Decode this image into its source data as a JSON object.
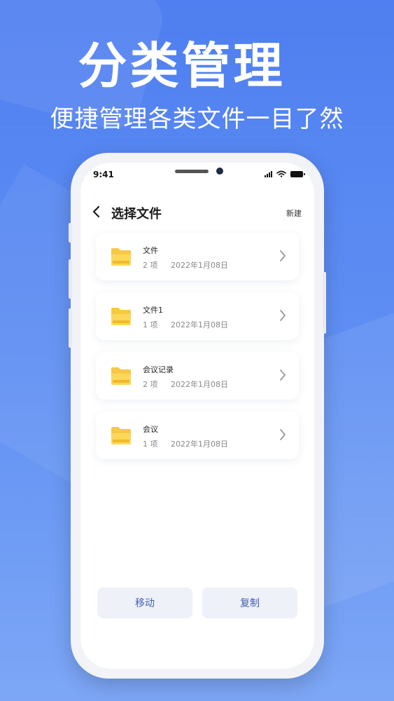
{
  "headline": "分类管理",
  "subline": "便捷管理各类文件一目了然",
  "status": {
    "time": "9:41"
  },
  "nav": {
    "title": "选择文件",
    "new_label": "新建"
  },
  "folders": [
    {
      "name": "文件",
      "count": "2 项",
      "date": "2022年1月08日"
    },
    {
      "name": "文件1",
      "count": "1 项",
      "date": "2022年1月08日"
    },
    {
      "name": "会议记录",
      "count": "2 项",
      "date": "2022年1月08日"
    },
    {
      "name": "会议",
      "count": "1 项",
      "date": "2022年1月08日"
    }
  ],
  "actions": {
    "move_label": "移动",
    "copy_label": "复制"
  },
  "colors": {
    "background": "#5f8ff3",
    "folder": "#f7c844",
    "accent": "#3f5fb0"
  },
  "icons": [
    "back-arrow-icon",
    "folder-icon",
    "chevron-right-icon",
    "signal-icon",
    "wifi-icon",
    "battery-icon"
  ]
}
